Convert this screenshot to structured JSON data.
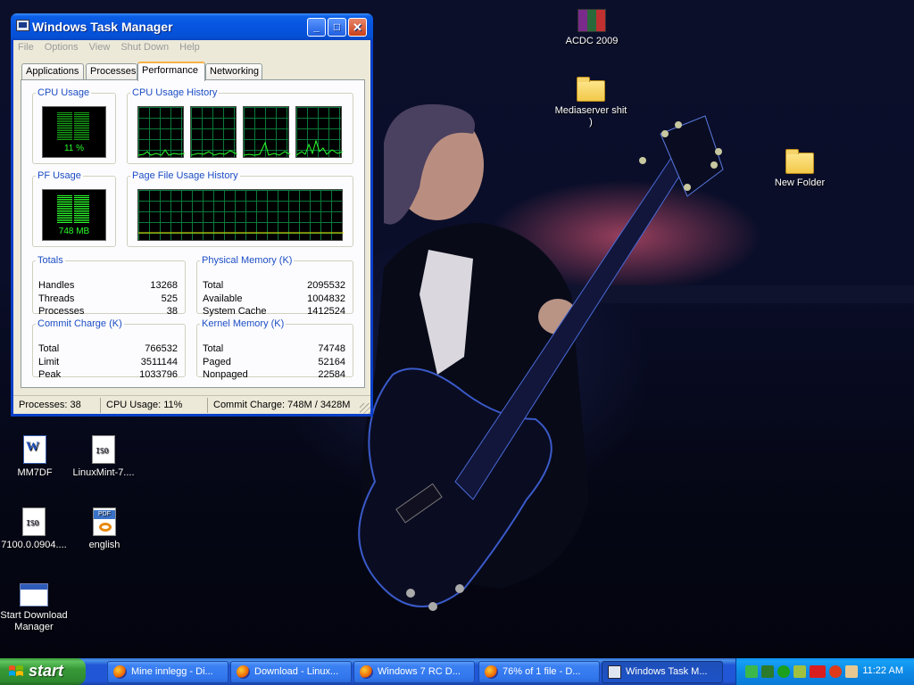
{
  "window": {
    "title": "Windows Task Manager",
    "menu": [
      "File",
      "Options",
      "View",
      "Shut Down",
      "Help"
    ],
    "tabs": [
      "Applications",
      "Processes",
      "Performance",
      "Networking"
    ],
    "active_tab": "Performance"
  },
  "performance": {
    "cpu_usage": {
      "title": "CPU Usage",
      "value": "11 %",
      "level_pct": 11
    },
    "cpu_history": {
      "title": "CPU Usage History"
    },
    "pf_usage": {
      "title": "PF Usage",
      "value": "748 MB"
    },
    "pf_history": {
      "title": "Page File Usage History"
    },
    "totals": {
      "title": "Totals",
      "rows": [
        {
          "label": "Handles",
          "value": "13268"
        },
        {
          "label": "Threads",
          "value": "525"
        },
        {
          "label": "Processes",
          "value": "38"
        }
      ]
    },
    "physical_memory": {
      "title": "Physical Memory (K)",
      "rows": [
        {
          "label": "Total",
          "value": "2095532"
        },
        {
          "label": "Available",
          "value": "1004832"
        },
        {
          "label": "System Cache",
          "value": "1412524"
        }
      ]
    },
    "commit_charge": {
      "title": "Commit Charge (K)",
      "rows": [
        {
          "label": "Total",
          "value": "766532"
        },
        {
          "label": "Limit",
          "value": "3511144"
        },
        {
          "label": "Peak",
          "value": "1033796"
        }
      ]
    },
    "kernel_memory": {
      "title": "Kernel Memory (K)",
      "rows": [
        {
          "label": "Total",
          "value": "74748"
        },
        {
          "label": "Paged",
          "value": "52164"
        },
        {
          "label": "Nonpaged",
          "value": "22584"
        }
      ]
    }
  },
  "statusbar": {
    "processes": "Processes: 38",
    "cpu": "CPU Usage: 11%",
    "commit": "Commit Charge: 748M / 3428M"
  },
  "desktop_icons": [
    {
      "name": "ACDC 2009",
      "icon": "winrar-archive-icon"
    },
    {
      "name": "Mediaserver shit )",
      "icon": "folder-icon"
    },
    {
      "name": "New Folder",
      "icon": "folder-icon"
    },
    {
      "name": "MM7DF",
      "icon": "word-document-icon"
    },
    {
      "name": "LinuxMint-7....",
      "icon": "disc-image-icon"
    },
    {
      "name": "7100.0.0904....",
      "icon": "disc-image-icon"
    },
    {
      "name": "english",
      "icon": "pdf-icon"
    },
    {
      "name": "Start Download Manager",
      "icon": "application-icon"
    }
  ],
  "taskbar": {
    "start_label": "start",
    "buttons": [
      {
        "label": "Mine innlegg - Di...",
        "icon": "firefox-icon"
      },
      {
        "label": "Download - Linux...",
        "icon": "firefox-icon"
      },
      {
        "label": "Windows 7 RC D...",
        "icon": "firefox-icon"
      },
      {
        "label": "76% of 1 file - D...",
        "icon": "firefox-icon"
      },
      {
        "label": "Windows Task M...",
        "icon": "task-manager-icon",
        "active": true
      }
    ],
    "clock": "11:22 AM"
  },
  "colors": {
    "titlebar": "#0654e0",
    "meter_green": "#2bff2b",
    "graph_grid": "#0a7a3a",
    "taskbar": "#2157d7",
    "start": "#379937"
  }
}
